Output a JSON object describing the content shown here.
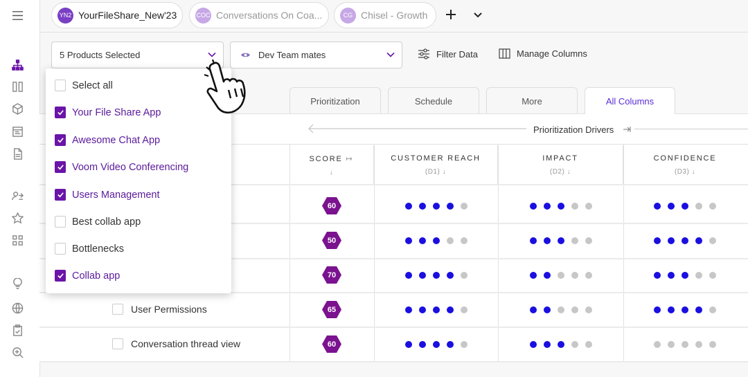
{
  "workspace_tabs": [
    {
      "initials": "YN2",
      "label": "YourFileShare_New'23",
      "color": "#7a3fc4"
    },
    {
      "initials": "COC",
      "label": "Conversations On Coa...",
      "color": "#c7a8e6"
    },
    {
      "initials": "CG",
      "label": "Chisel - Growth",
      "color": "#c7a8e6"
    }
  ],
  "toolbar": {
    "products_selector": "5 Products Selected",
    "team_selector": "Dev Team mates",
    "filter_label": "Filter Data",
    "columns_label": "Manage Columns"
  },
  "view_tabs": [
    "Prioritization",
    "Schedule",
    "More",
    "All Columns"
  ],
  "active_view_tab": "All Columns",
  "drivers_label": "Prioritization Drivers",
  "columns": [
    {
      "title": "SCORE",
      "sub": ""
    },
    {
      "title": "CUSTOMER REACH",
      "sub": "(D1)"
    },
    {
      "title": "IMPACT",
      "sub": "(D2)"
    },
    {
      "title": "CONFIDENCE",
      "sub": "(D3)"
    }
  ],
  "rows": [
    {
      "label": "",
      "score": "60",
      "reach": 4,
      "impact": 3,
      "confidence": 3
    },
    {
      "label": "",
      "score": "50",
      "reach": 3,
      "impact": 3,
      "confidence": 4
    },
    {
      "label": "",
      "score": "70",
      "reach": 4,
      "impact": 2,
      "confidence": 3
    },
    {
      "label": "User Permissions",
      "score": "65",
      "reach": 4,
      "impact": 2,
      "confidence": 4
    },
    {
      "label": "Conversation thread view",
      "score": "60",
      "reach": 4,
      "impact": 3,
      "confidence": 0
    }
  ],
  "dropdown": {
    "options": [
      {
        "label": "Select all",
        "checked": false
      },
      {
        "label": "Your File Share App",
        "checked": true
      },
      {
        "label": "Awesome Chat App",
        "checked": true
      },
      {
        "label": "Voom Video Conferencing",
        "checked": true
      },
      {
        "label": "Users Management",
        "checked": true
      },
      {
        "label": "Best collab app",
        "checked": false
      },
      {
        "label": "Bottlenecks",
        "checked": false
      },
      {
        "label": "Collab app",
        "checked": true
      }
    ]
  },
  "colors": {
    "accent": "#6a14a8",
    "dot_on": "#1a0fe0",
    "dot_off": "#c7c7c7",
    "score_badge": "#7b128f"
  },
  "icons": [
    "menu-icon",
    "hierarchy-icon",
    "columns-icon",
    "cube-icon",
    "board-icon",
    "document-icon",
    "person-swap-icon",
    "star-icon",
    "grid-icon",
    "bulb-icon",
    "globe-icon",
    "clipboard-check-icon",
    "search-zoom-icon",
    "plus-icon",
    "chevron-down-icon",
    "eye-icon",
    "sliders-icon",
    "columns-manage-icon",
    "hand-pointer-icon"
  ]
}
